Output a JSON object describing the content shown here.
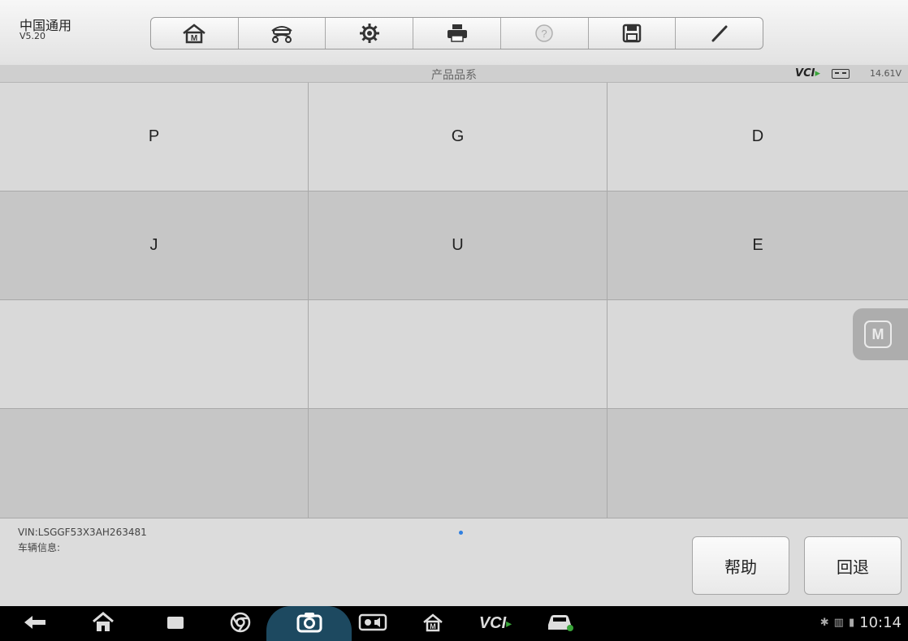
{
  "app": {
    "title": "中国通用",
    "version": "V5.20"
  },
  "toolbar": {
    "buttons": [
      {
        "icon": "home-icon"
      },
      {
        "icon": "car-lift-icon"
      },
      {
        "icon": "settings-icon"
      },
      {
        "icon": "print-icon"
      },
      {
        "icon": "help-icon"
      },
      {
        "icon": "save-icon"
      },
      {
        "icon": "edit-icon"
      }
    ]
  },
  "header": {
    "title": "产品品系",
    "vci_label": "VCI",
    "voltage": "14.61V"
  },
  "grid": {
    "rows": [
      [
        "P",
        "G",
        "D"
      ],
      [
        "J",
        "U",
        "E"
      ],
      [
        "",
        "",
        ""
      ],
      [
        "",
        "",
        ""
      ]
    ]
  },
  "footer": {
    "vin": "VIN:LSGGF53X3AH263481",
    "vehicle_info": "车辆信息:",
    "help_label": "帮助",
    "back_label": "回退"
  },
  "status": {
    "time": "10:14",
    "vci_nav_label": "VCI"
  },
  "colors": {
    "accent_blue": "#2f7fe0",
    "vci_green": "#3aa63a",
    "camera_highlight": "#1d4960"
  }
}
